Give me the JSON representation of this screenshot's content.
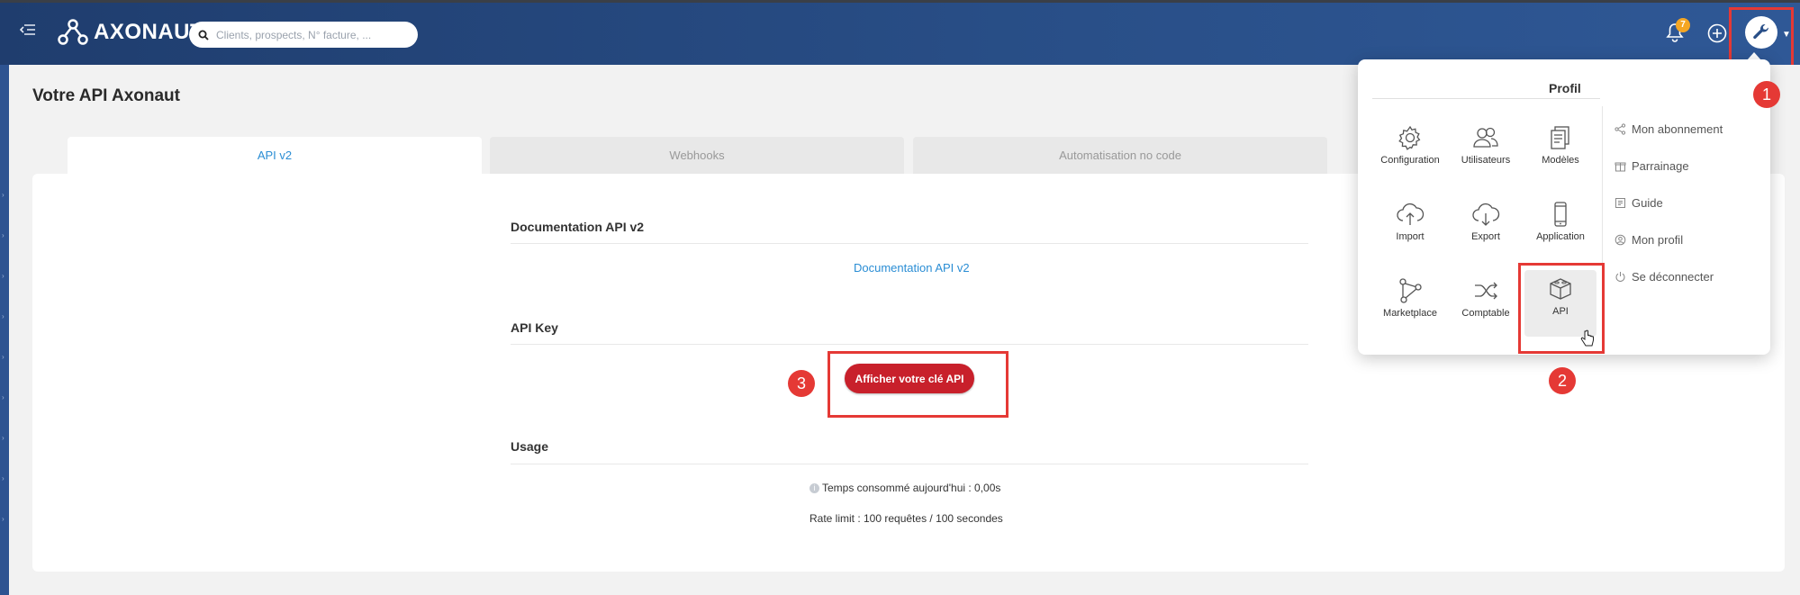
{
  "header": {
    "logo_text": "AXONAUT",
    "search_placeholder": "Clients, prospects, N° facture, ...",
    "notification_count": "7"
  },
  "page": {
    "title": "Votre API Axonaut",
    "tabs": [
      {
        "label": "API v2",
        "active": true
      },
      {
        "label": "Webhooks",
        "active": false
      },
      {
        "label": "Automatisation no code",
        "active": false
      }
    ]
  },
  "sections": {
    "documentation": {
      "title": "Documentation API v2",
      "link_label": "Documentation API v2"
    },
    "api_key": {
      "title": "API Key",
      "button_label": "Afficher votre clé API"
    },
    "usage": {
      "title": "Usage",
      "time_consumed": "Temps consommé aujourd'hui : 0,00s",
      "rate_limit": "Rate limit : 100 requêtes / 100 secondes"
    }
  },
  "dropdown": {
    "title": "Profil",
    "grid": [
      {
        "label": "Configuration",
        "icon": "gear-icon"
      },
      {
        "label": "Utilisateurs",
        "icon": "users-icon"
      },
      {
        "label": "Modèles",
        "icon": "documents-icon"
      },
      {
        "label": "Import",
        "icon": "cloud-upload-icon"
      },
      {
        "label": "Export",
        "icon": "cloud-download-icon"
      },
      {
        "label": "Application",
        "icon": "mobile-icon"
      },
      {
        "label": "Marketplace",
        "icon": "nodes-icon"
      },
      {
        "label": "Comptable",
        "icon": "shuffle-icon"
      },
      {
        "label": "API",
        "icon": "cube-icon",
        "selected": true
      }
    ],
    "links": [
      {
        "label": "Mon abonnement",
        "icon": "share-icon"
      },
      {
        "label": "Parrainage",
        "icon": "gift-icon"
      },
      {
        "label": "Guide",
        "icon": "book-icon"
      },
      {
        "label": "Mon profil",
        "icon": "user-circle-icon"
      },
      {
        "label": "Se déconnecter",
        "icon": "power-icon"
      }
    ]
  },
  "annotations": [
    "1",
    "2",
    "3"
  ],
  "colors": {
    "header_blue": "#294f88",
    "accent_blue": "#2a8dd4",
    "button_red": "#c8202b",
    "highlight_red": "#e53935",
    "badge_orange": "#f5a623"
  }
}
